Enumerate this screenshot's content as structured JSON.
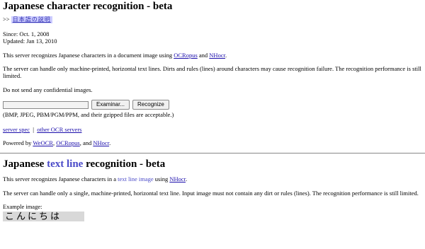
{
  "section1": {
    "title": "Japanese character recognition - beta",
    "lang_prefix": ">>",
    "lang_link": "日本語の説明",
    "since": "Since: Oct. 1, 2008",
    "updated": "Updated: Jan 13, 2010",
    "intro_pre": "This server recognizes Japanese characters in a document image using ",
    "ocropus_link": "OCRopus",
    "and": " and ",
    "nhocr_link": "NHocr",
    "period": ".",
    "limits": "The server can handle only machine-printed, horizontal text lines. Dirts and rules (lines) around characters may cause recognition failure. The recognition performance is still limited.",
    "warning": "Do not send any confidential images.",
    "browse_label": "Examinar...",
    "recognize_label": "Recognize",
    "formats": "(BMP, JPEG, PBM/PGM/PPM, and their gzipped files are acceptable.)",
    "server_spec_link": "server spec",
    "separator": "|",
    "other_ocr_link": "other OCR servers",
    "powered_pre": "Powered by ",
    "weocr_link": "WeOCR",
    "comma": ", ",
    "comma_and": ", and "
  },
  "section2": {
    "title_pre": "Japanese ",
    "title_highlight": "text line",
    "title_post": " recognition - beta",
    "intro_pre": "This server recognizes Japanese characters in a ",
    "text_line_link": "text line image",
    "using": " using ",
    "nhocr_link": "NHocr",
    "period": ".",
    "limits": "The server can handle only a single, machine-printed, horizontal text line. Input image must not contain any dirt or rules (lines). The recognition performance is still limited.",
    "example_label": "Example image:",
    "example_text": "こんにちは"
  }
}
